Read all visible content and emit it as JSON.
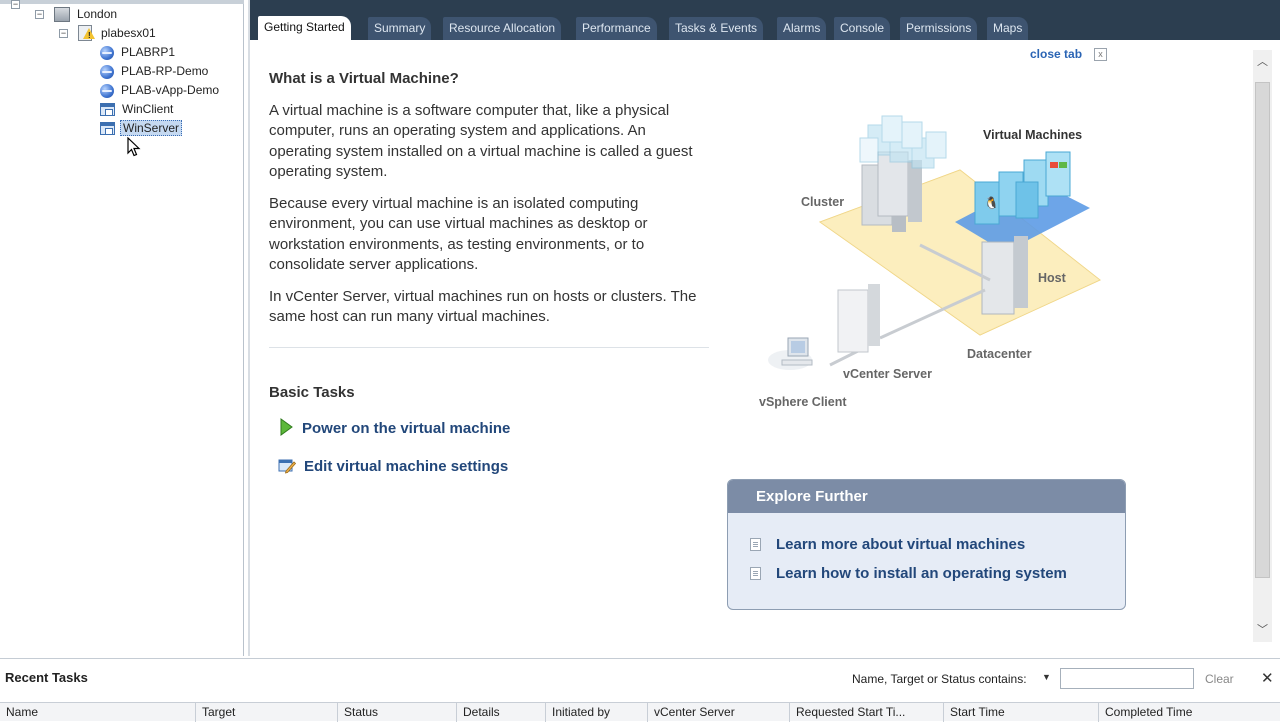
{
  "tree": {
    "items": [
      {
        "label": "London",
        "type": "datacenter"
      },
      {
        "label": "plabesx01",
        "type": "host-warning"
      },
      {
        "label": "PLABRP1",
        "type": "resource-pool"
      },
      {
        "label": "PLAB-RP-Demo",
        "type": "resource-pool"
      },
      {
        "label": "PLAB-vApp-Demo",
        "type": "vapp"
      },
      {
        "label": "WinClient",
        "type": "vm"
      },
      {
        "label": "WinServer",
        "type": "vm",
        "selected": true
      }
    ]
  },
  "tabs": [
    {
      "label": "Getting Started",
      "active": true
    },
    {
      "label": "Summary"
    },
    {
      "label": "Resource Allocation"
    },
    {
      "label": "Performance"
    },
    {
      "label": "Tasks & Events"
    },
    {
      "label": "Alarms"
    },
    {
      "label": "Console"
    },
    {
      "label": "Permissions"
    },
    {
      "label": "Maps"
    }
  ],
  "close_tab": {
    "label": "close tab",
    "icon": "close-box-icon",
    "x": "x"
  },
  "getting_started": {
    "heading": "What is a Virtual Machine?",
    "paragraphs": [
      "A virtual machine is a software computer that, like a physical computer, runs an operating system and applications. An operating system installed on a virtual machine is called a guest operating system.",
      "Because every virtual machine is an isolated computing environment, you can use virtual machines as desktop or workstation environments, as testing environments, or to consolidate server applications.",
      "In vCenter Server, virtual machines run on hosts or clusters. The same host can run many virtual machines."
    ],
    "basic_tasks_heading": "Basic Tasks",
    "tasks": [
      {
        "label": "Power on the virtual machine",
        "icon": "play-icon"
      },
      {
        "label": "Edit virtual machine settings",
        "icon": "edit-settings-icon"
      }
    ]
  },
  "diagram": {
    "labels": {
      "virtual_machines": "Virtual Machines",
      "cluster": "Cluster",
      "host": "Host",
      "datacenter": "Datacenter",
      "vcenter_server": "vCenter Server",
      "vsphere_client": "vSphere Client"
    }
  },
  "explore": {
    "title": "Explore Further",
    "links": [
      "Learn more about virtual machines",
      "Learn how to install an operating system"
    ]
  },
  "recent_tasks": {
    "title": "Recent Tasks",
    "filter_label": "Name, Target or Status contains:",
    "filter_value": "",
    "clear_label": "Clear",
    "close_glyph": "✕",
    "columns": [
      "Name",
      "Target",
      "Status",
      "Details",
      "Initiated by",
      "vCenter Server",
      "Requested Start Ti...",
      "Start Time",
      "Completed Time"
    ]
  },
  "colors": {
    "tabbar": "#2c3e50",
    "link": "#22477a",
    "close_tab_link": "#2a64b4",
    "explore_header": "#7c8ca6",
    "selection": "#c5d9f1"
  }
}
